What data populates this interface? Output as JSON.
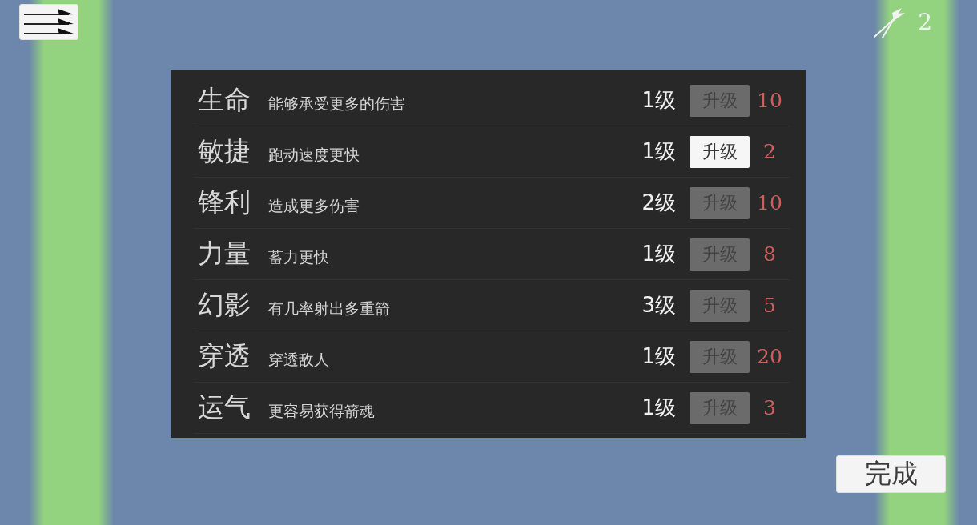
{
  "top_bar": {
    "arrow_count": "2"
  },
  "upgrades": [
    {
      "name": "生命",
      "description": "能够承受更多的伤害",
      "rank": "1级",
      "button": "升级",
      "disabled": true,
      "cost": "10"
    },
    {
      "name": "敏捷",
      "description": "跑动速度更快",
      "rank": "1级",
      "button": "升级",
      "disabled": false,
      "cost": "2"
    },
    {
      "name": "锋利",
      "description": "造成更多伤害",
      "rank": "2级",
      "button": "升级",
      "disabled": true,
      "cost": "10"
    },
    {
      "name": "力量",
      "description": "蓄力更快",
      "rank": "1级",
      "button": "升级",
      "disabled": true,
      "cost": "8"
    },
    {
      "name": "幻影",
      "description": "有几率射出多重箭",
      "rank": "3级",
      "button": "升级",
      "disabled": true,
      "cost": "5"
    },
    {
      "name": "穿透",
      "description": "穿透敌人",
      "rank": "1级",
      "button": "升级",
      "disabled": true,
      "cost": "20"
    },
    {
      "name": "运气",
      "description": "更容易获得箭魂",
      "rank": "1级",
      "button": "升级",
      "disabled": true,
      "cost": "3"
    }
  ],
  "done_button": "完成"
}
